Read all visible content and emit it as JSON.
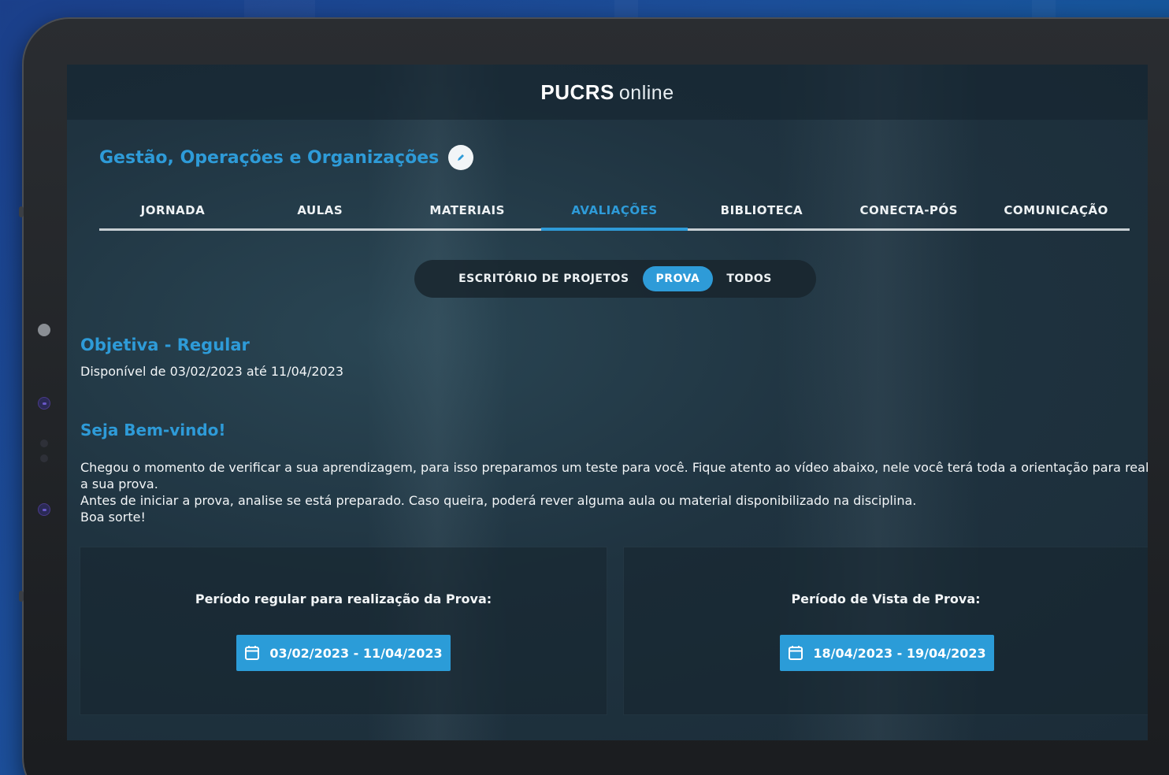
{
  "app": {
    "logo_strong": "PUCRS",
    "logo_light": "online"
  },
  "course": {
    "title": "Gestão, Operações e Organizações",
    "edit_icon": "pencil-icon"
  },
  "tabs": [
    {
      "label": "JORNADA",
      "active": false
    },
    {
      "label": "AULAS",
      "active": false
    },
    {
      "label": "MATERIAIS",
      "active": false
    },
    {
      "label": "AVALIAÇÕES",
      "active": true
    },
    {
      "label": "BIBLIOTECA",
      "active": false
    },
    {
      "label": "CONECTA-PÓS",
      "active": false
    },
    {
      "label": "COMUNICAÇÃO",
      "active": false
    }
  ],
  "filters": [
    {
      "label": "ESCRITÓRIO DE PROJETOS",
      "active": false
    },
    {
      "label": "PROVA",
      "active": true
    },
    {
      "label": "TODOS",
      "active": false
    }
  ],
  "assessment": {
    "title": "Objetiva - Regular",
    "availability": "Disponível de 03/02/2023 até 11/04/2023"
  },
  "welcome": {
    "title": "Seja Bem-vindo!",
    "lines": [
      "Chegou o momento de verificar a sua aprendizagem, para isso preparamos um teste para você. Fique atento ao vídeo abaixo, nele você terá toda a orientação para realizar",
      "a sua prova.",
      "Antes de iniciar a prova, analise se está preparado. Caso queira, poderá rever alguma aula ou material disponibilizado na disciplina.",
      "Boa sorte!"
    ]
  },
  "cards": [
    {
      "label": "Período regular para realização da Prova:",
      "date_range": "03/02/2023 - 11/04/2023",
      "icon": "calendar-icon"
    },
    {
      "label": "Período de Vista de Prova:",
      "date_range": "18/04/2023 - 19/04/2023",
      "icon": "calendar-icon"
    }
  ],
  "colors": {
    "accent": "#2e9bd8",
    "text": "#f2f5f7"
  }
}
